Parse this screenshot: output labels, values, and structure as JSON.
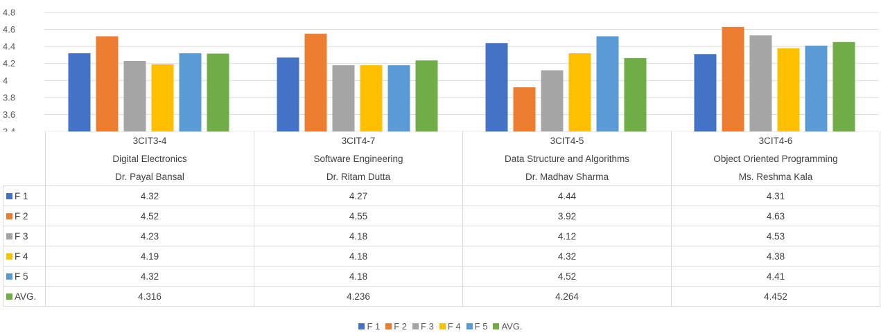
{
  "chart_data": {
    "type": "bar",
    "y_ticks": [
      "4.8",
      "4.6",
      "4.4",
      "4.2",
      "4",
      "3.8",
      "3.6",
      "3.4"
    ],
    "ylim": [
      3.4,
      4.8
    ],
    "grid": true,
    "legend_position": "bottom",
    "categories": [
      {
        "code": "3CIT3-4",
        "subject": "Digital Electronics",
        "teacher": "Dr. Payal Bansal"
      },
      {
        "code": "3CIT4-7",
        "subject": "Software Engineering",
        "teacher": "Dr. Ritam Dutta"
      },
      {
        "code": "3CIT4-5",
        "subject": "Data Structure and Algorithms",
        "teacher": "Dr. Madhav Sharma"
      },
      {
        "code": "3CIT4-6",
        "subject": "Object Oriented Programming",
        "teacher": "Ms. Reshma Kala"
      }
    ],
    "series": [
      {
        "name": "F 1",
        "color": "#4472C4",
        "values": [
          "4.32",
          "4.27",
          "4.44",
          "4.31"
        ]
      },
      {
        "name": "F 2",
        "color": "#ED7D31",
        "values": [
          "4.52",
          "4.55",
          "3.92",
          "4.63"
        ]
      },
      {
        "name": "F 3",
        "color": "#A5A5A5",
        "values": [
          "4.23",
          "4.18",
          "4.12",
          "4.53"
        ]
      },
      {
        "name": "F 4",
        "color": "#FFC000",
        "values": [
          "4.19",
          "4.18",
          "4.32",
          "4.38"
        ]
      },
      {
        "name": "F 5",
        "color": "#5B9BD5",
        "values": [
          "4.32",
          "4.18",
          "4.52",
          "4.41"
        ]
      },
      {
        "name": "AVG.",
        "color": "#70AD47",
        "values": [
          "4.316",
          "4.236",
          "4.264",
          "4.452"
        ]
      }
    ]
  }
}
